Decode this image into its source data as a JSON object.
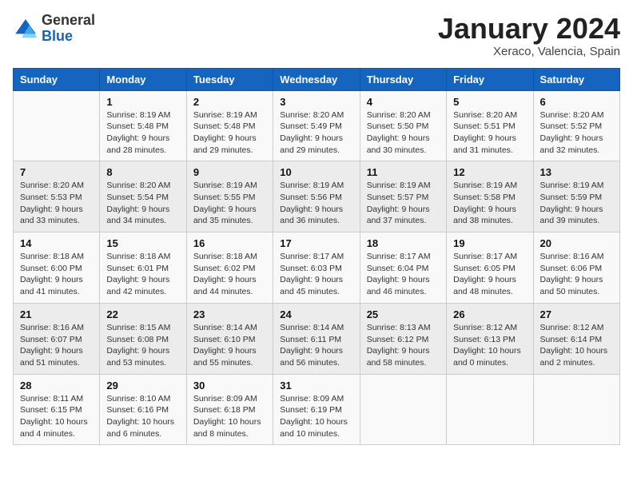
{
  "logo": {
    "general": "General",
    "blue": "Blue"
  },
  "header": {
    "month": "January 2024",
    "location": "Xeraco, Valencia, Spain"
  },
  "weekdays": [
    "Sunday",
    "Monday",
    "Tuesday",
    "Wednesday",
    "Thursday",
    "Friday",
    "Saturday"
  ],
  "weeks": [
    [
      {
        "day": "",
        "info": ""
      },
      {
        "day": "1",
        "info": "Sunrise: 8:19 AM\nSunset: 5:48 PM\nDaylight: 9 hours\nand 28 minutes."
      },
      {
        "day": "2",
        "info": "Sunrise: 8:19 AM\nSunset: 5:48 PM\nDaylight: 9 hours\nand 29 minutes."
      },
      {
        "day": "3",
        "info": "Sunrise: 8:20 AM\nSunset: 5:49 PM\nDaylight: 9 hours\nand 29 minutes."
      },
      {
        "day": "4",
        "info": "Sunrise: 8:20 AM\nSunset: 5:50 PM\nDaylight: 9 hours\nand 30 minutes."
      },
      {
        "day": "5",
        "info": "Sunrise: 8:20 AM\nSunset: 5:51 PM\nDaylight: 9 hours\nand 31 minutes."
      },
      {
        "day": "6",
        "info": "Sunrise: 8:20 AM\nSunset: 5:52 PM\nDaylight: 9 hours\nand 32 minutes."
      }
    ],
    [
      {
        "day": "7",
        "info": "Sunrise: 8:20 AM\nSunset: 5:53 PM\nDaylight: 9 hours\nand 33 minutes."
      },
      {
        "day": "8",
        "info": "Sunrise: 8:20 AM\nSunset: 5:54 PM\nDaylight: 9 hours\nand 34 minutes."
      },
      {
        "day": "9",
        "info": "Sunrise: 8:19 AM\nSunset: 5:55 PM\nDaylight: 9 hours\nand 35 minutes."
      },
      {
        "day": "10",
        "info": "Sunrise: 8:19 AM\nSunset: 5:56 PM\nDaylight: 9 hours\nand 36 minutes."
      },
      {
        "day": "11",
        "info": "Sunrise: 8:19 AM\nSunset: 5:57 PM\nDaylight: 9 hours\nand 37 minutes."
      },
      {
        "day": "12",
        "info": "Sunrise: 8:19 AM\nSunset: 5:58 PM\nDaylight: 9 hours\nand 38 minutes."
      },
      {
        "day": "13",
        "info": "Sunrise: 8:19 AM\nSunset: 5:59 PM\nDaylight: 9 hours\nand 39 minutes."
      }
    ],
    [
      {
        "day": "14",
        "info": "Sunrise: 8:18 AM\nSunset: 6:00 PM\nDaylight: 9 hours\nand 41 minutes."
      },
      {
        "day": "15",
        "info": "Sunrise: 8:18 AM\nSunset: 6:01 PM\nDaylight: 9 hours\nand 42 minutes."
      },
      {
        "day": "16",
        "info": "Sunrise: 8:18 AM\nSunset: 6:02 PM\nDaylight: 9 hours\nand 44 minutes."
      },
      {
        "day": "17",
        "info": "Sunrise: 8:17 AM\nSunset: 6:03 PM\nDaylight: 9 hours\nand 45 minutes."
      },
      {
        "day": "18",
        "info": "Sunrise: 8:17 AM\nSunset: 6:04 PM\nDaylight: 9 hours\nand 46 minutes."
      },
      {
        "day": "19",
        "info": "Sunrise: 8:17 AM\nSunset: 6:05 PM\nDaylight: 9 hours\nand 48 minutes."
      },
      {
        "day": "20",
        "info": "Sunrise: 8:16 AM\nSunset: 6:06 PM\nDaylight: 9 hours\nand 50 minutes."
      }
    ],
    [
      {
        "day": "21",
        "info": "Sunrise: 8:16 AM\nSunset: 6:07 PM\nDaylight: 9 hours\nand 51 minutes."
      },
      {
        "day": "22",
        "info": "Sunrise: 8:15 AM\nSunset: 6:08 PM\nDaylight: 9 hours\nand 53 minutes."
      },
      {
        "day": "23",
        "info": "Sunrise: 8:14 AM\nSunset: 6:10 PM\nDaylight: 9 hours\nand 55 minutes."
      },
      {
        "day": "24",
        "info": "Sunrise: 8:14 AM\nSunset: 6:11 PM\nDaylight: 9 hours\nand 56 minutes."
      },
      {
        "day": "25",
        "info": "Sunrise: 8:13 AM\nSunset: 6:12 PM\nDaylight: 9 hours\nand 58 minutes."
      },
      {
        "day": "26",
        "info": "Sunrise: 8:12 AM\nSunset: 6:13 PM\nDaylight: 10 hours\nand 0 minutes."
      },
      {
        "day": "27",
        "info": "Sunrise: 8:12 AM\nSunset: 6:14 PM\nDaylight: 10 hours\nand 2 minutes."
      }
    ],
    [
      {
        "day": "28",
        "info": "Sunrise: 8:11 AM\nSunset: 6:15 PM\nDaylight: 10 hours\nand 4 minutes."
      },
      {
        "day": "29",
        "info": "Sunrise: 8:10 AM\nSunset: 6:16 PM\nDaylight: 10 hours\nand 6 minutes."
      },
      {
        "day": "30",
        "info": "Sunrise: 8:09 AM\nSunset: 6:18 PM\nDaylight: 10 hours\nand 8 minutes."
      },
      {
        "day": "31",
        "info": "Sunrise: 8:09 AM\nSunset: 6:19 PM\nDaylight: 10 hours\nand 10 minutes."
      },
      {
        "day": "",
        "info": ""
      },
      {
        "day": "",
        "info": ""
      },
      {
        "day": "",
        "info": ""
      }
    ]
  ]
}
